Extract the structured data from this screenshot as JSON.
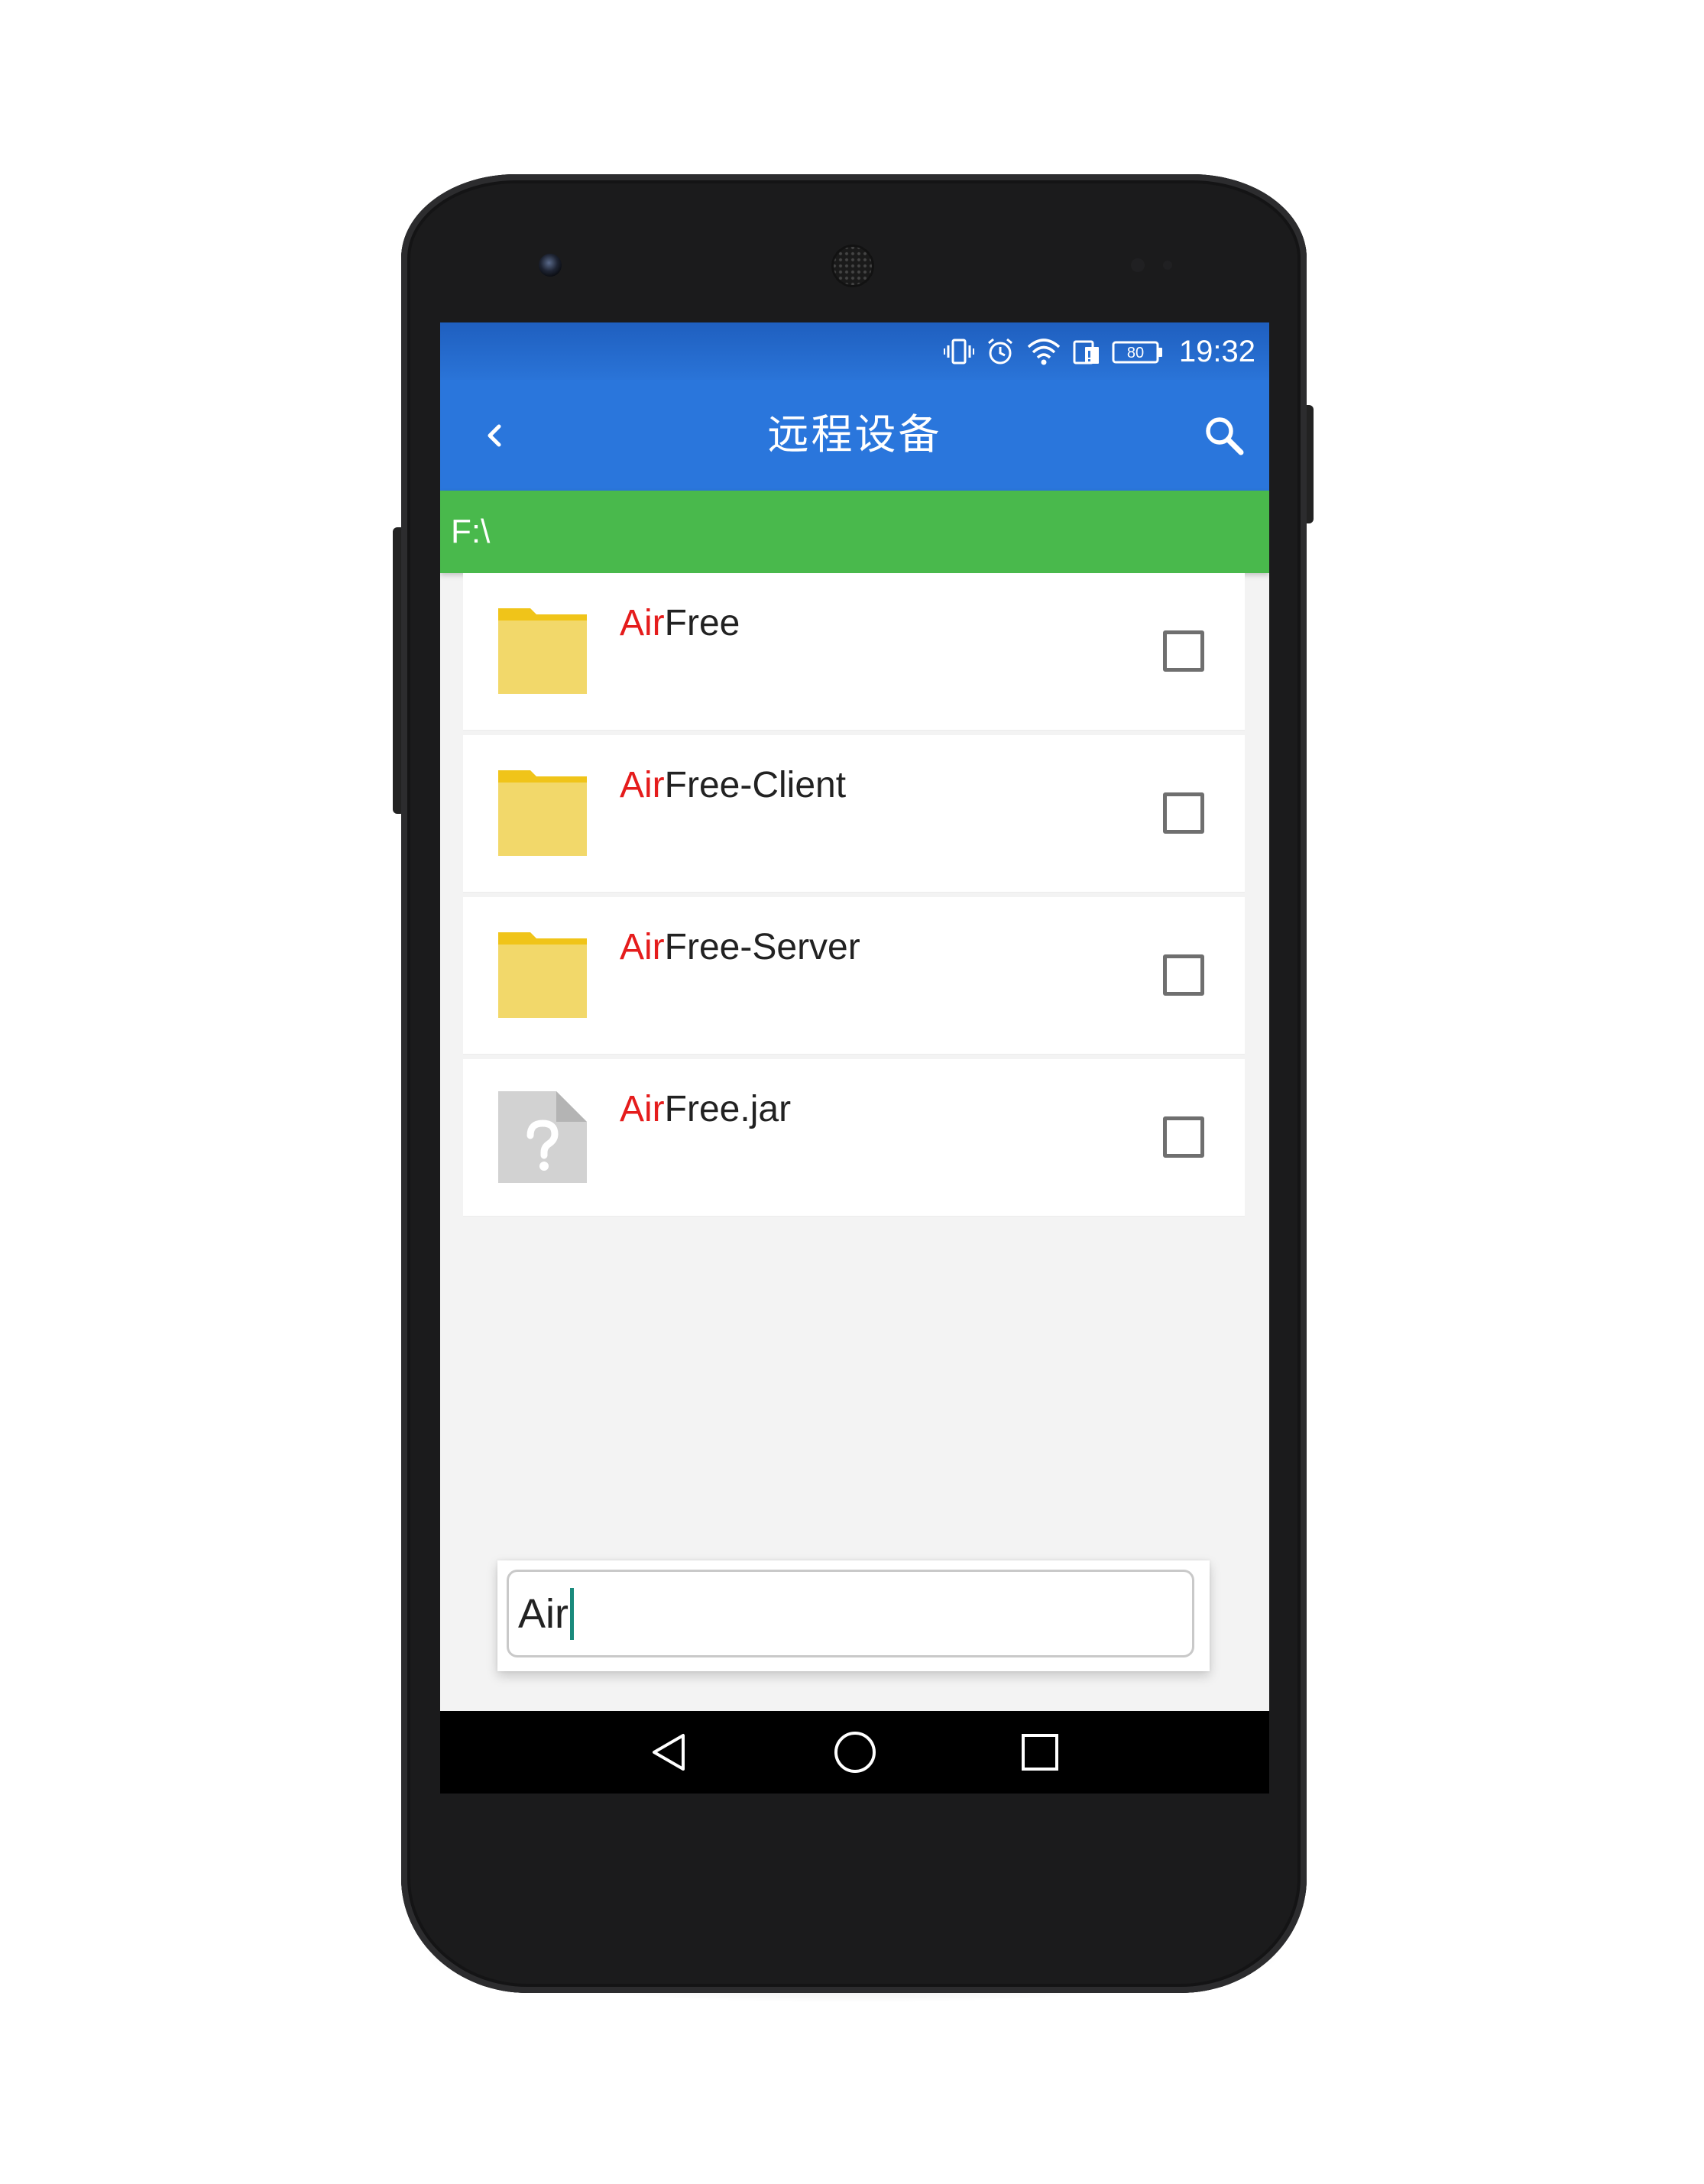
{
  "statusbar": {
    "battery_level": "80",
    "time": "19:32",
    "icons": [
      "vibrate-icon",
      "alarm-icon",
      "wifi-icon",
      "sim-icon",
      "battery-icon"
    ]
  },
  "appbar": {
    "title": "远程设备",
    "back_icon": "chevron-left-icon",
    "search_icon": "search-icon"
  },
  "path": {
    "current": "F:\\"
  },
  "files": [
    {
      "match": "Air",
      "rest": "Free",
      "type": "folder",
      "checked": false
    },
    {
      "match": "Air",
      "rest": "Free-Client",
      "type": "folder",
      "checked": false
    },
    {
      "match": "Air",
      "rest": "Free-Server",
      "type": "folder",
      "checked": false
    },
    {
      "match": "Air",
      "rest": "Free.jar",
      "type": "unknown-file",
      "checked": false
    }
  ],
  "search": {
    "value": "Air"
  },
  "navbar": {
    "icons": [
      "back-triangle-icon",
      "home-circle-icon",
      "recents-square-icon"
    ]
  },
  "colors": {
    "appbar": "#2a76dc",
    "pathbar": "#49b94c",
    "highlight": "#e51c1c",
    "folder": "#f2d86a",
    "folder_tab": "#f0c419",
    "caret": "#1a8a7c"
  }
}
